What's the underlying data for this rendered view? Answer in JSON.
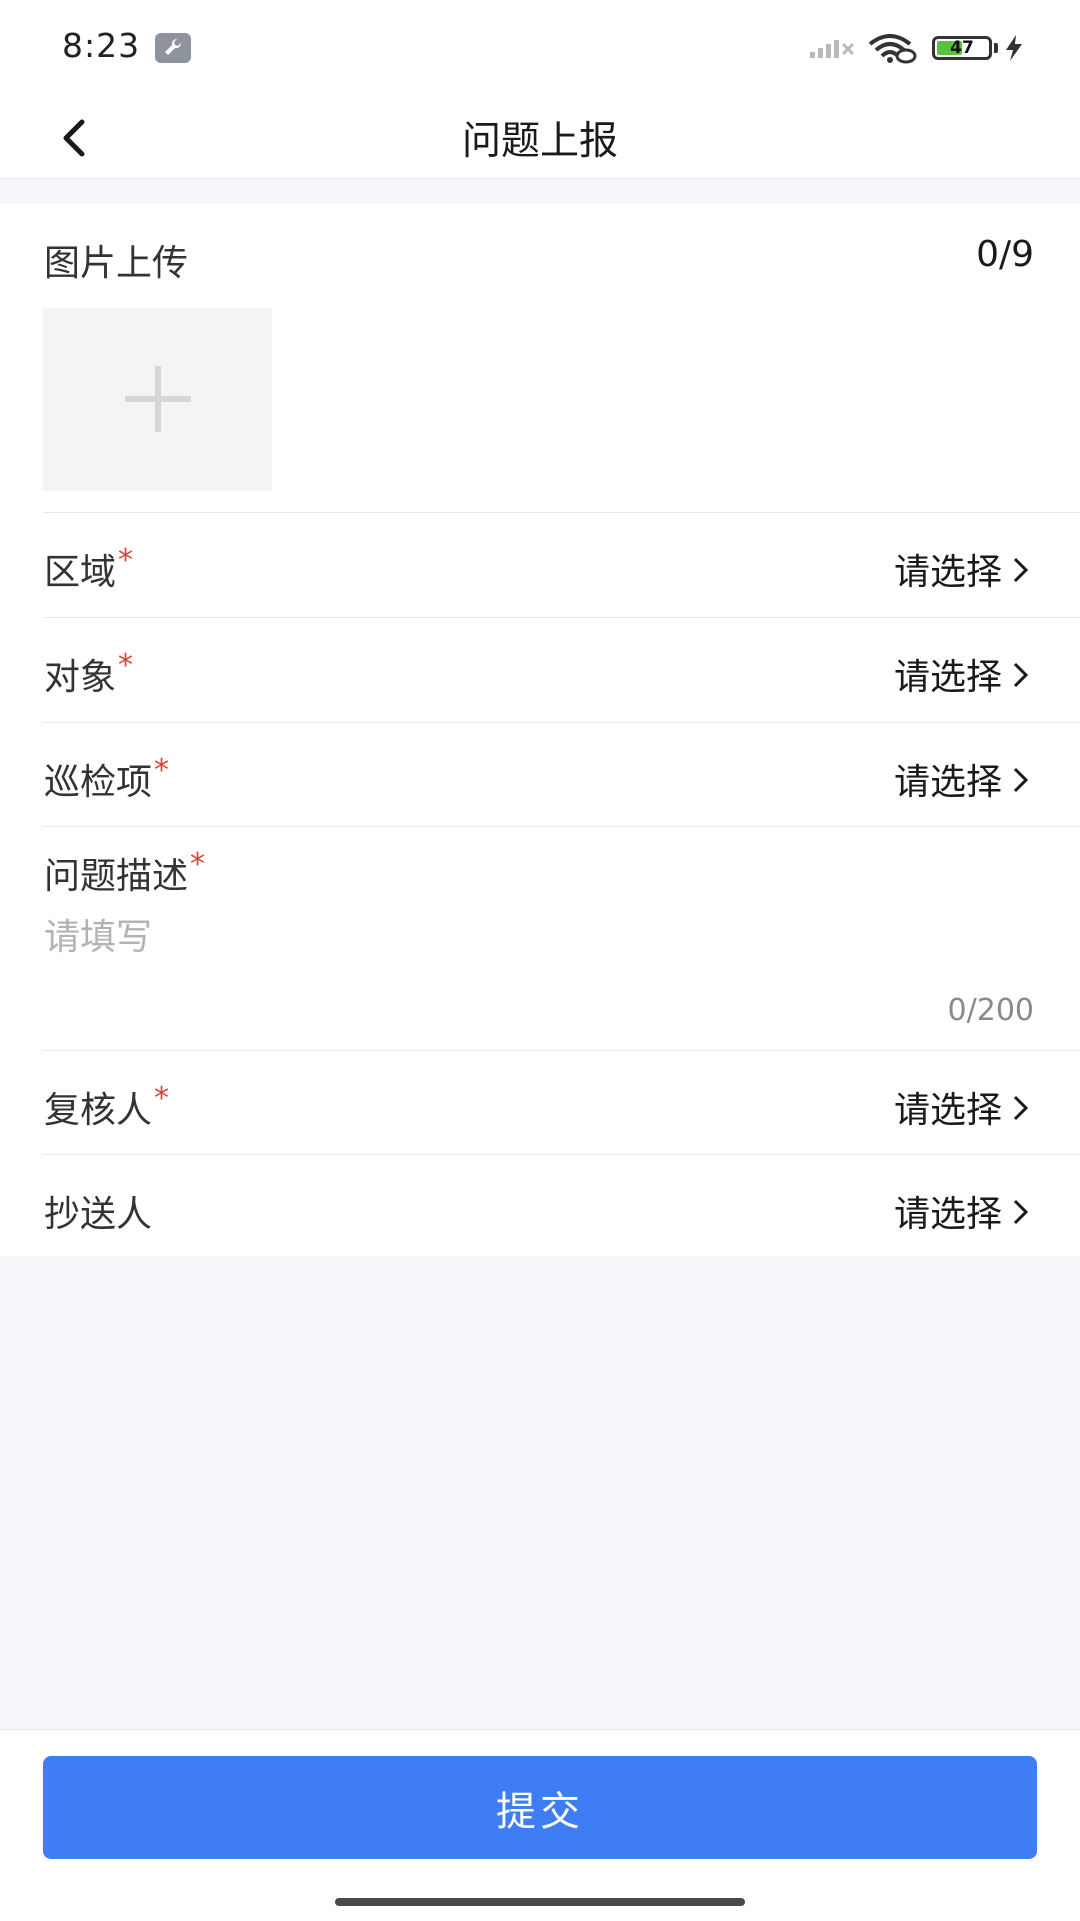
{
  "status_bar": {
    "time": "8:23",
    "battery_level": "47",
    "icons": [
      "wrench-icon",
      "signal-icon",
      "wifi-icon",
      "battery-icon",
      "charging-bolt-icon"
    ]
  },
  "nav": {
    "title": "问题上报",
    "back_icon": "chevron-left-icon"
  },
  "upload": {
    "label": "图片上传",
    "count": "0/9",
    "add_icon": "plus-icon"
  },
  "fields": [
    {
      "label": "区域",
      "required": "*",
      "value": "请选择"
    },
    {
      "label": "对象",
      "required": "*",
      "value": "请选择"
    },
    {
      "label": "巡检项",
      "required": "*",
      "value": "请选择"
    },
    {
      "label": "复核人",
      "required": "*",
      "value": "请选择"
    },
    {
      "label": "抄送人",
      "value": "请选择"
    }
  ],
  "description": {
    "label": "问题描述",
    "required": "*",
    "placeholder": "请填写",
    "value": "",
    "counter": "0/200"
  },
  "submit": {
    "label": "提交",
    "color": "#3f7df4"
  },
  "colors": {
    "required": "#d9433a",
    "background": "#f5f6fa"
  }
}
